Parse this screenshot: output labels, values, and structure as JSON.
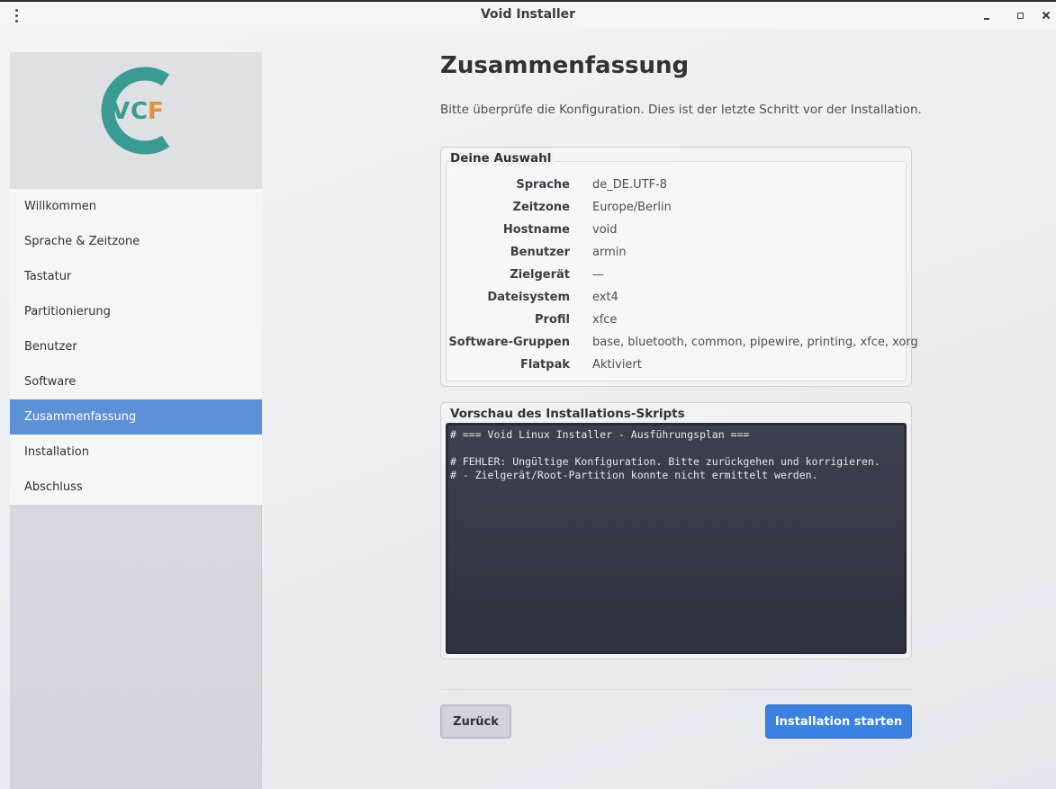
{
  "window": {
    "title": "Void Installer"
  },
  "logo": {
    "text_v": "V",
    "text_c": "C",
    "text_f": "F",
    "ring_color": "#3a9b94",
    "vc_color": "#3a9b94",
    "f_color": "#e0923a"
  },
  "sidebar": {
    "items": [
      {
        "label": "Willkommen",
        "active": false
      },
      {
        "label": "Sprache & Zeitzone",
        "active": false
      },
      {
        "label": "Tastatur",
        "active": false
      },
      {
        "label": "Partitionierung",
        "active": false
      },
      {
        "label": "Benutzer",
        "active": false
      },
      {
        "label": "Software",
        "active": false
      },
      {
        "label": "Zusammenfassung",
        "active": true
      },
      {
        "label": "Installation",
        "active": false
      },
      {
        "label": "Abschluss",
        "active": false
      }
    ]
  },
  "main": {
    "title": "Zusammenfassung",
    "subtitle": "Bitte überprüfe die Konfiguration. Dies ist der letzte Schritt vor der Installation.",
    "selection": {
      "label": "Deine Auswahl",
      "rows": [
        {
          "key": "Sprache",
          "value": "de_DE.UTF-8"
        },
        {
          "key": "Zeitzone",
          "value": "Europe/Berlin"
        },
        {
          "key": "Hostname",
          "value": "void"
        },
        {
          "key": "Benutzer",
          "value": "armin"
        },
        {
          "key": "Zielgerät",
          "value": "—"
        },
        {
          "key": "Dateisystem",
          "value": "ext4"
        },
        {
          "key": "Profil",
          "value": "xfce"
        },
        {
          "key": "Software-Gruppen",
          "value": "base, bluetooth, common, pipewire, printing, xfce, xorg"
        },
        {
          "key": "Flatpak",
          "value": "Aktiviert"
        }
      ]
    },
    "preview": {
      "label": "Vorschau des Installations-Skripts",
      "script": "# === Void Linux Installer - Ausführungsplan ===\n\n# FEHLER: Ungültige Konfiguration. Bitte zurückgehen und korrigieren.\n# - Zielgerät/Root-Partition konnte nicht ermittelt werden."
    },
    "buttons": {
      "back": "Zurück",
      "install": "Installation starten"
    }
  },
  "colors": {
    "accent": "#3b82e0",
    "sidebar_active": "#5c91d6"
  }
}
